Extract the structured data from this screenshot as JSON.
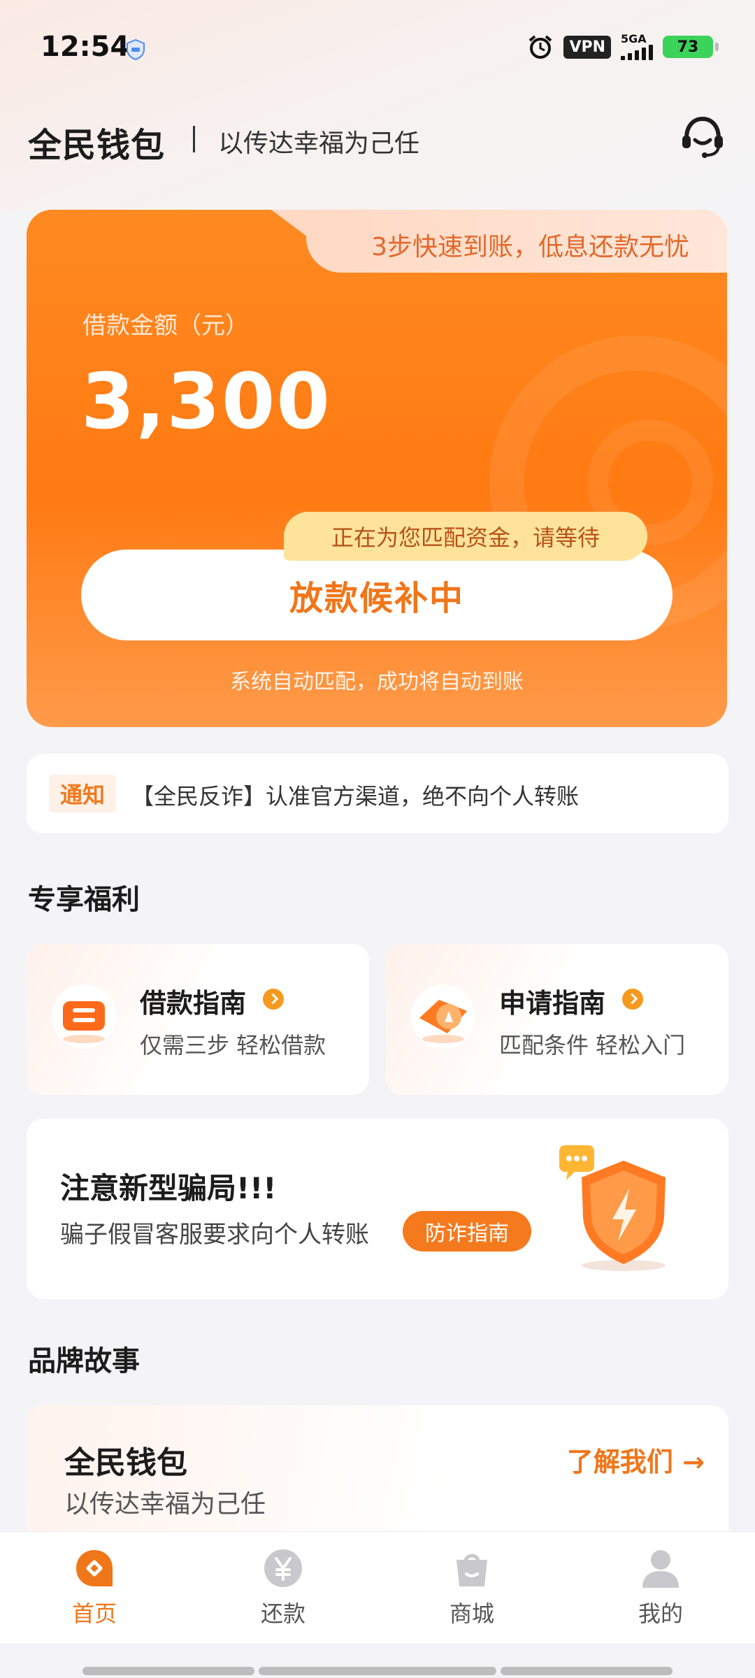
{
  "status_bar": {
    "time": "12:54",
    "vpn": "VPN",
    "network": "5GA",
    "battery": "73"
  },
  "header": {
    "brand": "全民钱包",
    "slogan": "以传达幸福为己任",
    "icon": "customer-service-icon"
  },
  "loan_card": {
    "tab_text": "3步快速到账，低息还款无忧",
    "amount_label": "借款金额（元）",
    "amount": "3,300",
    "matching_tag": "正在为您匹配资金，请等待",
    "status_button": "放款候补中",
    "auto_note": "系统自动匹配，成功将自动到账"
  },
  "notice": {
    "tag": "通知",
    "text": "【全民反诈】认准官方渠道，绝不向个人转账"
  },
  "benefits": {
    "title": "专享福利",
    "items": [
      {
        "title": "借款指南",
        "subtitle": "仅需三步 轻松借款",
        "icon": "ticket-icon"
      },
      {
        "title": "申请指南",
        "subtitle": "匹配条件 轻松入门",
        "icon": "compass-icon"
      }
    ]
  },
  "fraud_alert": {
    "title": "注意新型骗局!!!",
    "subtitle": "骗子假冒客服要求向个人转账",
    "button": "防诈指南",
    "icon": "shield-lightning-icon"
  },
  "brand_story": {
    "title": "品牌故事",
    "card_title": "全民钱包",
    "card_subtitle": "以传达幸福为己任",
    "link": "了解我们 →"
  },
  "bottom_nav": {
    "items": [
      {
        "label": "首页",
        "icon": "home-icon",
        "active": true
      },
      {
        "label": "还款",
        "icon": "yen-icon",
        "active": false
      },
      {
        "label": "商城",
        "icon": "shopping-bag-icon",
        "active": false
      },
      {
        "label": "我的",
        "icon": "user-icon",
        "active": false
      }
    ]
  },
  "colors": {
    "accent": "#f0761a",
    "card_orange": "#ff7a12"
  }
}
